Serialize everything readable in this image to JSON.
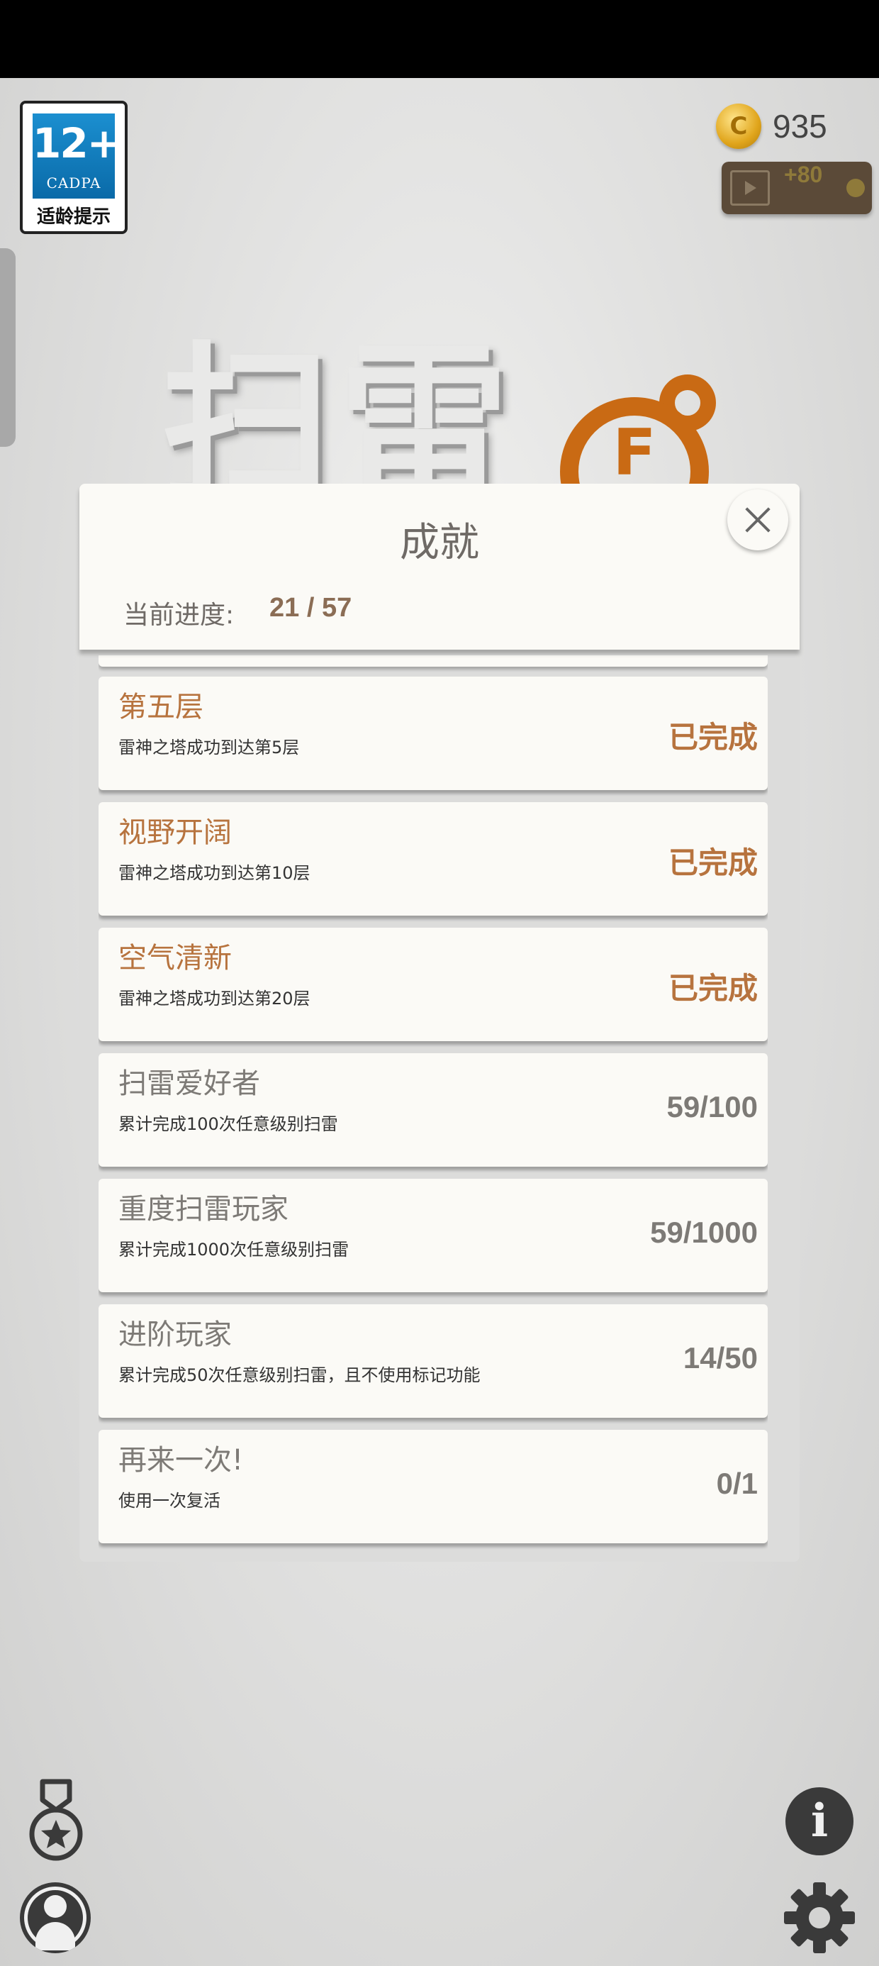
{
  "age_rating": {
    "number": "12+",
    "org": "CADPA",
    "caption": "适龄提示"
  },
  "coins": {
    "icon_letter": "C",
    "count": "935"
  },
  "video_bonus": {
    "icon": "film-play-icon",
    "amount": "+80"
  },
  "logo": {
    "text": "扫雷",
    "bomb_letter": "F"
  },
  "dialog": {
    "title": "成就",
    "progress_label": "当前进度:",
    "progress_value": "21 / 57",
    "close_icon": "close-icon"
  },
  "achievements": [
    {
      "name": "第五层",
      "desc": "雷神之塔成功到达第5层",
      "status": "已完成",
      "done": true
    },
    {
      "name": "视野开阔",
      "desc": "雷神之塔成功到达第10层",
      "status": "已完成",
      "done": true
    },
    {
      "name": "空气清新",
      "desc": "雷神之塔成功到达第20层",
      "status": "已完成",
      "done": true
    },
    {
      "name": "扫雷爱好者",
      "desc": "累计完成100次任意级别扫雷",
      "status": "59/100",
      "done": false
    },
    {
      "name": "重度扫雷玩家",
      "desc": "累计完成1000次任意级别扫雷",
      "status": "59/1000",
      "done": false
    },
    {
      "name": "进阶玩家",
      "desc": "累计完成50次任意级别扫雷，且不使用标记功能",
      "status": "14/50",
      "done": false
    },
    {
      "name": "再来一次!",
      "desc": "使用一次复活",
      "status": "0/1",
      "done": false
    }
  ],
  "bottom_icons": {
    "achievements": "medal-icon",
    "profile": "user-icon",
    "info": "info-icon",
    "settings": "gear-icon"
  },
  "colors": {
    "done": "#b7733e",
    "todo": "#7d7a76",
    "card_bg": "#fbfaf6",
    "accent_orange": "#c96a14"
  }
}
